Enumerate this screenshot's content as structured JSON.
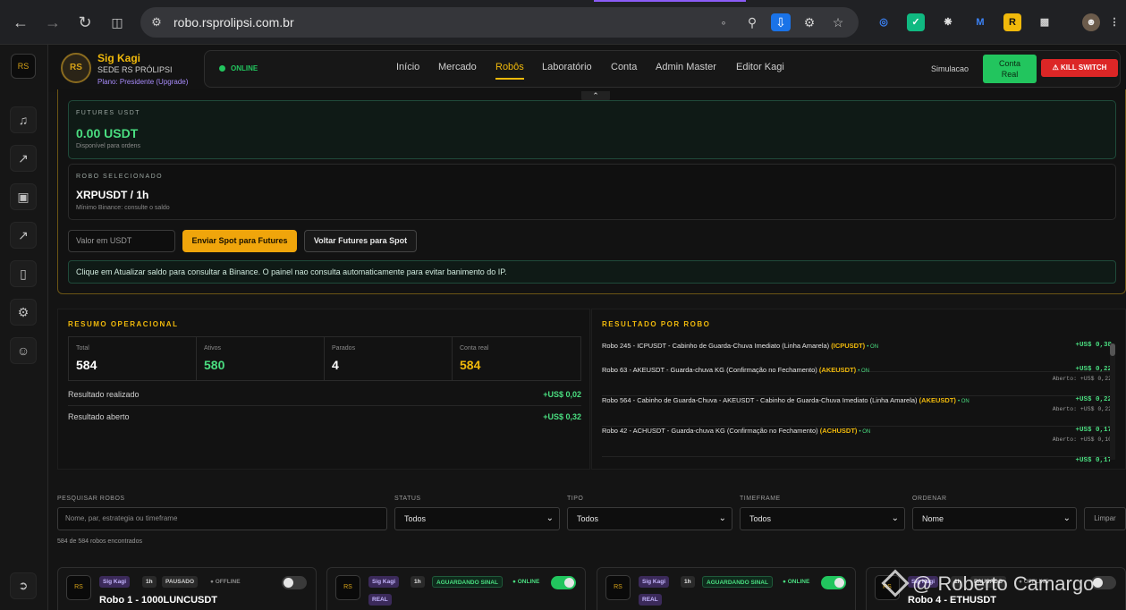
{
  "browser": {
    "url": "robo.rsprolipsi.com.br",
    "icons": {
      "back": "back-arrow-icon",
      "forward": "forward-arrow-icon",
      "reload": "reload-icon",
      "tabs": "split-tab-icon",
      "translate": "translate-icon",
      "zoom": "zoom-icon",
      "install": "install-app-icon",
      "password": "key-icon",
      "bookmark": "star-icon"
    }
  },
  "rail": {
    "logo": "RS",
    "items": [
      "bell-icon",
      "chart-line-icon",
      "lock-icon",
      "chart-icon",
      "columns-icon",
      "gear-icon",
      "user-icon"
    ],
    "exit": "logout-icon"
  },
  "header": {
    "logo_text": "RS",
    "name": "Sig Kagi",
    "subtitle": "SEDE RS PRÓLIPSI",
    "plan": "Plano: Presidente (Upgrade)",
    "status": "ONLINE",
    "tabs": [
      "Início",
      "Mercado",
      "Robôs",
      "Laboratório",
      "Conta",
      "Admin Master",
      "Editor Kagi"
    ],
    "active_tab": "Robôs",
    "simulacao": "Simulacao",
    "conta_real_1": "Conta",
    "conta_real_2": "Real",
    "kill_switch": "KILL SWITCH"
  },
  "futures": {
    "label": "FUTURES USDT",
    "value": "0.00 USDT",
    "note": "Disponível para ordens"
  },
  "robo_selecionado": {
    "label": "ROBO SELECIONADO",
    "value": "XRPUSDT / 1h",
    "note": "Mínimo Binance: consulte o saldo"
  },
  "transfer": {
    "input_placeholder": "Valor em USDT",
    "btn_spot_to_futures": "Enviar Spot para Futures",
    "btn_futures_to_spot": "Voltar Futures para Spot"
  },
  "info": "Clique em Atualizar saldo para consultar a Binance. O painel nao consulta automaticamente para evitar banimento do IP.",
  "resumo": {
    "title": "RESUMO OPERACIONAL",
    "stats": [
      {
        "label": "Total",
        "value": "584",
        "color": "#ffffff"
      },
      {
        "label": "Ativos",
        "value": "580",
        "color": "#4ade80"
      },
      {
        "label": "Parados",
        "value": "4",
        "color": "#ffffff"
      },
      {
        "label": "Conta real",
        "value": "584",
        "color": "#f0b90b"
      }
    ],
    "realizado_label": "Resultado realizado",
    "realizado_value": "+US$ 0,02",
    "aberto_label": "Resultado aberto",
    "aberto_value": "+US$ 0,32"
  },
  "resultado": {
    "title": "RESULTADO POR ROBO",
    "rows": [
      {
        "name": "Robo 245 - ICPUSDT - Cabinho de Guarda-Chuva Imediato (Linha Amarela)",
        "pair": "(ICPUSDT)",
        "status": "• ON",
        "value": "+US$ 0,38",
        "aberto": ""
      },
      {
        "name": "Robo 63 - AKEUSDT - Guarda-chuva KG (Confirmação no Fechamento)",
        "pair": "(AKEUSDT)",
        "status": "• ON",
        "value": "+US$ 0,22",
        "aberto": "Aberto: +US$ 0,22"
      },
      {
        "name": "Robo 564 - Cabinho de Guarda-Chuva - AKEUSDT - Cabinho de Guarda-Chuva Imediato (Linha Amarela)",
        "pair": "(AKEUSDT)",
        "status": "• ON",
        "value": "+US$ 0,22",
        "aberto": "Aberto: +US$ 0,22"
      },
      {
        "name": "Robo 42 - ACHUSDT - Guarda-chuva KG (Confirmação no Fechamento)",
        "pair": "(ACHUSDT)",
        "status": "• ON",
        "value": "+US$ 0,17",
        "aberto": "Aberto: +US$ 0,10"
      },
      {
        "name": "",
        "pair": "",
        "status": "",
        "value": "+US$ 0,17",
        "aberto": ""
      }
    ]
  },
  "filters": {
    "search_label": "PESQUISAR ROBOS",
    "search_placeholder": "Nome, par, estrategia ou timeframe",
    "status_label": "STATUS",
    "status_value": "Todos",
    "tipo_label": "TIPO",
    "tipo_value": "Todos",
    "timeframe_label": "TIMEFRAME",
    "timeframe_value": "Todos",
    "ordenar_label": "ORDENAR",
    "ordenar_value": "Nome",
    "limpar": "Limpar",
    "count": "584 de 584 robos encontrados"
  },
  "robots": [
    {
      "logo": "RS",
      "owner": "Sig Kagi",
      "tf": "1h",
      "state": "PAUSADO",
      "conn": "● OFFLINE",
      "real": "",
      "title": "Robo 1 - 1000LUNCUSDT",
      "enabled": false
    },
    {
      "logo": "RS",
      "owner": "Sig Kagi",
      "tf": "1h",
      "state": "AGUARDANDO SINAL",
      "conn": "● ONLINE",
      "real": "REAL",
      "title": "",
      "enabled": true
    },
    {
      "logo": "RS",
      "owner": "Sig Kagi",
      "tf": "1h",
      "state": "AGUARDANDO SINAL",
      "conn": "● ONLINE",
      "real": "REAL",
      "title": "",
      "enabled": true
    },
    {
      "logo": "RS",
      "owner": "Sig Kagi",
      "tf": "1h",
      "state": "PAUSADO",
      "conn": "● OFFLINE",
      "real": "",
      "title": "Robo 4 - ETHUSDT",
      "enabled": false
    }
  ],
  "watermark": "@ Roberto Camargo"
}
